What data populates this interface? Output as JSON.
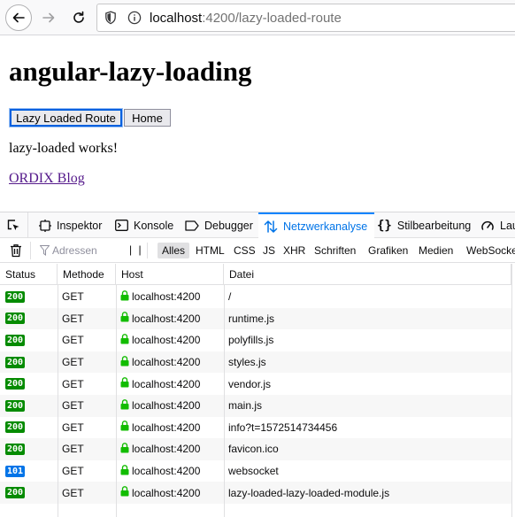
{
  "browser": {
    "url_host": "localhost",
    "url_rest": ":4200/lazy-loaded-route",
    "icons": [
      "back-arrow-icon",
      "forward-arrow-icon",
      "reload-icon",
      "shield-icon",
      "info-icon"
    ]
  },
  "page": {
    "title": "angular-lazy-loading",
    "buttons": {
      "lazy": "Lazy Loaded Route",
      "home": "Home"
    },
    "message": "lazy-loaded works!",
    "link": "ORDIX Blog"
  },
  "devtools": {
    "tabs": [
      "Inspektor",
      "Konsole",
      "Debugger",
      "Netzwerkanalyse",
      "Stilbearbeitung",
      "Lau"
    ],
    "active_tab": "Netzwerkanalyse",
    "filter_placeholder": "Adressen",
    "pause_label": "| |",
    "type_filters": [
      "Alles",
      "HTML",
      "CSS",
      "JS",
      "XHR",
      "Schriften",
      "Grafiken",
      "Medien",
      "WebSocke"
    ],
    "active_filter": "Alles",
    "columns": [
      "Status",
      "Methode",
      "Host",
      "Datei"
    ],
    "rows": [
      {
        "status": "200",
        "method": "GET",
        "host": "localhost:4200",
        "file": "/"
      },
      {
        "status": "200",
        "method": "GET",
        "host": "localhost:4200",
        "file": "runtime.js"
      },
      {
        "status": "200",
        "method": "GET",
        "host": "localhost:4200",
        "file": "polyfills.js"
      },
      {
        "status": "200",
        "method": "GET",
        "host": "localhost:4200",
        "file": "styles.js"
      },
      {
        "status": "200",
        "method": "GET",
        "host": "localhost:4200",
        "file": "vendor.js"
      },
      {
        "status": "200",
        "method": "GET",
        "host": "localhost:4200",
        "file": "main.js"
      },
      {
        "status": "200",
        "method": "GET",
        "host": "localhost:4200",
        "file": "info?t=1572514734456"
      },
      {
        "status": "200",
        "method": "GET",
        "host": "localhost:4200",
        "file": "favicon.ico"
      },
      {
        "status": "101",
        "method": "GET",
        "host": "localhost:4200",
        "file": "websocket"
      },
      {
        "status": "200",
        "method": "GET",
        "host": "localhost:4200",
        "file": "lazy-loaded-lazy-loaded-module.js"
      }
    ],
    "colors": {
      "status_200": "#058b00",
      "status_101": "#0074e8",
      "accent": "#0a84ff",
      "lock": "#12bc00"
    }
  }
}
